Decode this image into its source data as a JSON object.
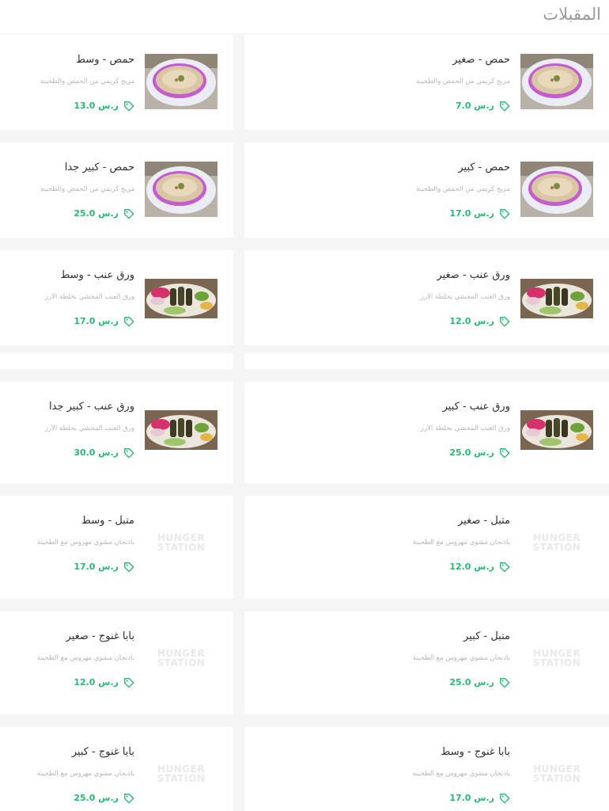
{
  "section": {
    "title": "المقبلات"
  },
  "placeholder_logo": {
    "line1": "HUNGER",
    "line2": "STATION"
  },
  "colors": {
    "price": "#2bb673",
    "title": "#9a9a9a"
  },
  "items": [
    {
      "name": "حمص - صغير",
      "desc": "مزيج كريمي من الحمص والطحينة",
      "price": "7.0 ر.س",
      "image": "hummus"
    },
    {
      "name": "حمص - وسط",
      "desc": "مزيج كريمي من الحمص والطحينة",
      "price": "13.0 ر.س",
      "image": "hummus"
    },
    {
      "name": "حمص - كبير",
      "desc": "مزيج كريمي من الحمص والطحينة",
      "price": "17.0 ر.س",
      "image": "hummus"
    },
    {
      "name": "حمص - كبير جدا",
      "desc": "مزيج كريمي من الحمص والطحينة",
      "price": "25.0 ر.س",
      "image": "hummus"
    },
    {
      "name": "ورق عنب - صغير",
      "desc": "ورق العنب المحشي بخلطة الأرز",
      "price": "12.0 ر.س",
      "image": "grape-leaves"
    },
    {
      "name": "ورق عنب - وسط",
      "desc": "ورق العنب المحشي بخلطة الأرز",
      "price": "17.0 ر.س",
      "image": "grape-leaves"
    },
    {
      "name": "ورق عنب - كبير",
      "desc": "ورق العنب المحشي بخلطة الأرز",
      "price": "25.0 ر.س",
      "image": "grape-leaves"
    },
    {
      "name": "ورق عنب - كبير جدا",
      "desc": "ورق العنب المحشي بخلطة الأرز",
      "price": "30.0 ر.س",
      "image": "grape-leaves"
    },
    {
      "name": "متبل - صغير",
      "desc": "باذنجان مشوي مهروس مع الطحينة",
      "price": "12.0 ر.س",
      "image": "placeholder"
    },
    {
      "name": "متبل - وسط",
      "desc": "باذنجان مشوي مهروس مع الطحينة",
      "price": "17.0 ر.س",
      "image": "placeholder"
    },
    {
      "name": "متبل - كبير",
      "desc": "باذنجان مشوي مهروس مع الطحينة",
      "price": "25.0 ر.س",
      "image": "placeholder"
    },
    {
      "name": "بابا غنوج - صغير",
      "desc": "باذنجان مشوي مهروس مع الطحينة",
      "price": "12.0 ر.س",
      "image": "placeholder"
    },
    {
      "name": "بابا غنوج - وسط",
      "desc": "باذنجان مشوي مهروس مع الطحينة",
      "price": "17.0 ر.س",
      "image": "placeholder"
    },
    {
      "name": "بابا غنوج - كبير",
      "desc": "باذنجان مشوي مهروس مع الطحينة",
      "price": "25.0 ر.س",
      "image": "placeholder"
    }
  ]
}
